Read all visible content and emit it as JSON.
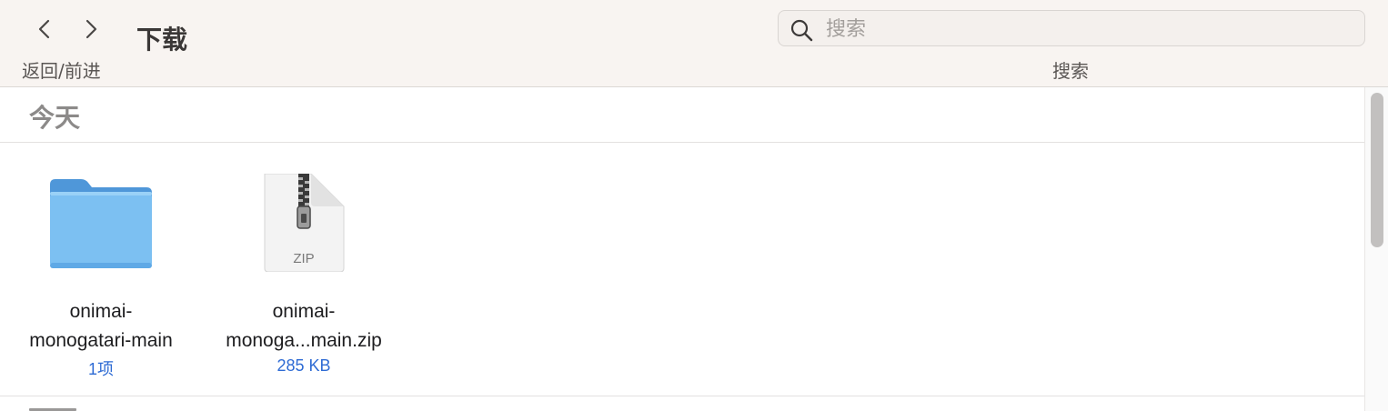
{
  "toolbar": {
    "back_forward_label": "返回/前进",
    "title": "下载",
    "search_placeholder": "搜索",
    "search_label": "搜索"
  },
  "section": {
    "header": "今天"
  },
  "items": [
    {
      "name_line1": "onimai-",
      "name_line2": "monogatari-main",
      "meta": "1项",
      "icon": "folder-icon"
    },
    {
      "name_line1": "onimai-",
      "name_line2": "monoga...main.zip",
      "meta": "285 KB",
      "icon": "zip-file-icon",
      "badge": "ZIP"
    }
  ],
  "colors": {
    "toolbar_bg": "#f8f4f1",
    "folder_blue": "#7cc0f2",
    "meta_blue": "#2e6bd4"
  }
}
